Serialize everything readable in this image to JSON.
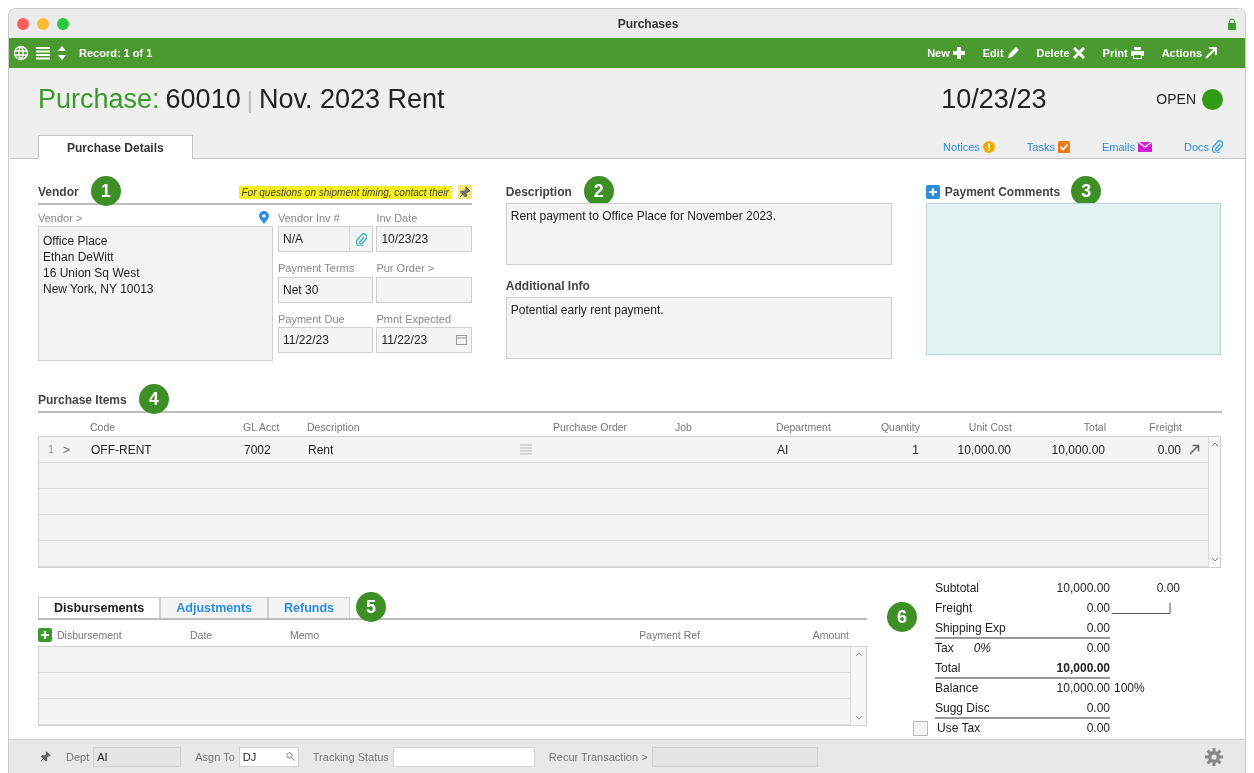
{
  "window": {
    "title": "Purchases"
  },
  "toolbar": {
    "record": "Record: 1 of 1",
    "actions": [
      {
        "label": "New"
      },
      {
        "label": "Edit"
      },
      {
        "label": "Delete"
      },
      {
        "label": "Print"
      },
      {
        "label": "Actions"
      }
    ]
  },
  "header": {
    "label": "Purchase:",
    "number": "60010",
    "separator": "|",
    "name": "Nov. 2023 Rent",
    "date": "10/23/23",
    "status": "OPEN"
  },
  "tabs": [
    {
      "label": "Purchase Details",
      "selected": true
    }
  ],
  "links": [
    {
      "label": "Notices"
    },
    {
      "label": "Tasks"
    },
    {
      "label": "Emails"
    },
    {
      "label": "Docs"
    }
  ],
  "vendor": {
    "heading": "Vendor",
    "badge": "1",
    "notice": "For questions on shipment timing, contact their",
    "field_label": "Vendor >",
    "address": [
      "Office Place",
      "Ethan DeWitt",
      "16 Union Sq West",
      "New York, NY 10013"
    ],
    "fields": [
      {
        "label": "Vendor Inv #",
        "value": "N/A",
        "kind": "attach"
      },
      {
        "label": "Inv Date",
        "value": "10/23/23",
        "kind": "text"
      },
      {
        "label": "Payment Terms",
        "value": "Net 30",
        "kind": "text"
      },
      {
        "label": "Pur Order >",
        "kind": "text"
      },
      {
        "label": "Payment Due",
        "value": "11/22/23",
        "kind": "text"
      },
      {
        "label": "Pmnt Expected",
        "value": "11/22/23",
        "kind": "calendar"
      }
    ]
  },
  "description": {
    "heading": "Description",
    "badge": "2",
    "value": "Rent payment to Office Place for November 2023."
  },
  "additional_info": {
    "heading": "Additional Info",
    "value": "Potential early rent payment."
  },
  "payment_comments": {
    "heading": "Payment Comments",
    "badge": "3"
  },
  "purchase_items": {
    "heading": "Purchase Items",
    "badge": "4",
    "columns": [
      {
        "label": "Code",
        "kind": "text"
      },
      {
        "label": "GL Acct",
        "kind": "text"
      },
      {
        "label": "Description",
        "kind": "memo"
      },
      {
        "label": "Purchase Order",
        "kind": "text"
      },
      {
        "label": "Job",
        "kind": "text"
      },
      {
        "label": "Department",
        "kind": "text"
      },
      {
        "label": "Quantity",
        "kind": "number"
      },
      {
        "label": "Unit Cost",
        "kind": "number"
      },
      {
        "label": "Total",
        "kind": "number"
      },
      {
        "label": "Freight",
        "kind": "number"
      }
    ],
    "rows": [
      {
        "line": "1",
        "expander": ">",
        "cells": [
          "OFF-RENT",
          "7002",
          "Rent",
          null,
          null,
          "AI",
          "1",
          "10,000.00",
          "10,000.00",
          "0.00"
        ]
      }
    ]
  },
  "disbursements": {
    "badge": "5",
    "tabs": [
      {
        "label": "Disbursements",
        "selected": true
      },
      {
        "label": "Adjustments",
        "selected": false
      },
      {
        "label": "Refunds",
        "selected": false
      }
    ],
    "columns": [
      {
        "label": "Disbursement",
        "kind": "add"
      },
      {
        "label": "Date",
        "kind": "text"
      },
      {
        "label": "Memo",
        "kind": "text"
      },
      {
        "label": "Payment Ref",
        "kind": "right"
      },
      {
        "label": "Amount",
        "kind": "right"
      }
    ]
  },
  "totals": {
    "badge": "6",
    "rows": [
      {
        "label": "Subtotal",
        "value": "10,000.00",
        "extra": "0.00",
        "kind": "plain",
        "bold": false,
        "rule_after": false
      },
      {
        "label": "Freight",
        "value": "0.00",
        "kind": "linked",
        "bold": false,
        "rule_after": false
      },
      {
        "label": "Shipping Exp",
        "value": "0.00",
        "kind": "plain",
        "bold": false,
        "rule_after": true
      },
      {
        "label": "Tax",
        "rate": "0%",
        "value": "0.00",
        "kind": "plain",
        "bold": false,
        "rule_after": false
      },
      {
        "label": "Total",
        "value": "10,000.00",
        "kind": "plain",
        "bold": true,
        "rule_after": true
      },
      {
        "label": "Balance",
        "value": "10,000.00",
        "extra": "100%",
        "kind": "plain",
        "bold": false,
        "rule_after": false
      },
      {
        "label": "Sugg Disc",
        "value": "0.00",
        "kind": "plain",
        "bold": false,
        "rule_after": true
      },
      {
        "label": "Use Tax",
        "value": "0.00",
        "kind": "checkbox",
        "checked": false,
        "bold": false,
        "rule_after": false
      }
    ]
  },
  "footer": {
    "fields": [
      {
        "label": "Dept",
        "value": "AI",
        "kind": "text"
      },
      {
        "label": "Asgn To",
        "value": "DJ",
        "kind": "search"
      },
      {
        "label": "Tracking Status",
        "kind": "text"
      },
      {
        "label": "Recur Transaction >",
        "kind": "disabled"
      }
    ]
  }
}
